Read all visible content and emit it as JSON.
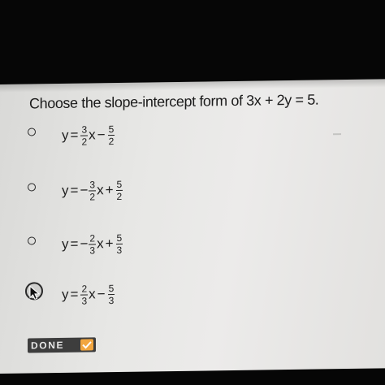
{
  "question": {
    "text": "Choose the slope-intercept form of 3x + 2y = 5."
  },
  "options": [
    {
      "lhs": "y",
      "eq": "=",
      "sign1": "",
      "frac1": {
        "num": "3",
        "den": "2"
      },
      "var": "x",
      "op": "−",
      "frac2": {
        "num": "5",
        "den": "2"
      },
      "selected": false
    },
    {
      "lhs": "y",
      "eq": "=",
      "sign1": "−",
      "frac1": {
        "num": "3",
        "den": "2"
      },
      "var": "x",
      "op": "+",
      "frac2": {
        "num": "5",
        "den": "2"
      },
      "selected": false
    },
    {
      "lhs": "y",
      "eq": "=",
      "sign1": "−",
      "frac1": {
        "num": "2",
        "den": "3"
      },
      "var": "x",
      "op": "+",
      "frac2": {
        "num": "5",
        "den": "3"
      },
      "selected": false
    },
    {
      "lhs": "y",
      "eq": "=",
      "sign1": "",
      "frac1": {
        "num": "2",
        "den": "3"
      },
      "var": "x",
      "op": "−",
      "frac2": {
        "num": "5",
        "den": "3"
      },
      "selected": true
    }
  ],
  "done_button": {
    "label": "DONE",
    "icon": "check-icon",
    "icon_color": "#f2a640"
  },
  "colors": {
    "panel": "#e7e7e5",
    "text": "#1b1b1b",
    "button": "#3d3d3d"
  }
}
